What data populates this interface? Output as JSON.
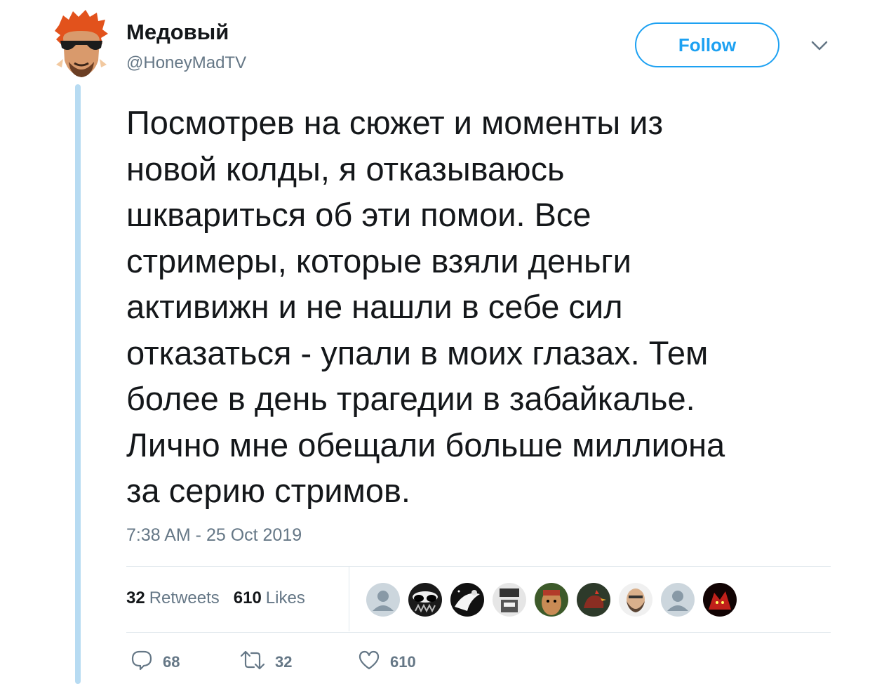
{
  "tweet": {
    "author_name": "Медовый",
    "author_handle": "@HoneyMadTV",
    "follow_label": "Follow",
    "text_lines": [
      "Посмотрев на сюжет и моменты из",
      "новой колды, я отказываюсь",
      "шквариться об эти помои. Все",
      "стримеры, которые взяли деньги",
      "активижн и не нашли в себе сил",
      "отказаться - упали в моих глазах. Тем",
      "более в день трагедии в забайкалье.",
      "Лично мне обещали больше миллиона",
      "за серию стримов."
    ],
    "timestamp": "7:38 AM - 25 Oct 2019"
  },
  "stats": {
    "retweets_count": "32",
    "retweets_label": "Retweets",
    "likes_count": "610",
    "likes_label": "Likes"
  },
  "likers": [
    "default-avatar",
    "alien-avatar",
    "space-avatar",
    "gamer-avatar",
    "face-avatar",
    "rooster-avatar",
    "bearded-avatar",
    "default-avatar",
    "red-creature-avatar"
  ],
  "actions": {
    "reply_count": "68",
    "retweet_count": "32",
    "like_count": "610"
  },
  "colors": {
    "accent": "#1da1f2",
    "thread_line": "#b7dbf2",
    "secondary_text": "#657786"
  }
}
